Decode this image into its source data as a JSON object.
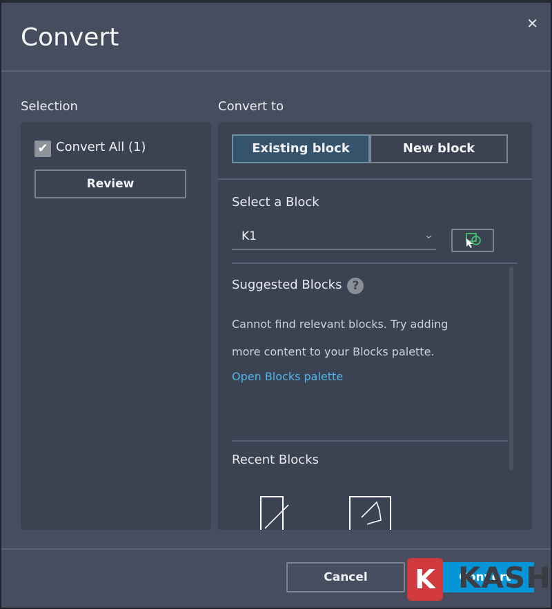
{
  "dialog": {
    "title": "Convert",
    "close_icon": "close-icon"
  },
  "selection": {
    "label": "Selection",
    "convert_all": "Convert All (1)",
    "checked": true,
    "review": "Review"
  },
  "convert_to": {
    "label": "Convert to",
    "tabs": [
      {
        "label": "Existing block",
        "active": true
      },
      {
        "label": "New block",
        "active": false
      }
    ],
    "select_block_label": "Select a Block",
    "select_value": "K1",
    "pick_icon": "pick-block-icon",
    "suggested_label": "Suggested Blocks",
    "help_glyph": "?",
    "message_line1": "Cannot find relevant blocks. Try adding",
    "message_line2": "more content to your Blocks palette.",
    "open_palette": "Open Blocks palette",
    "recent_label": "Recent Blocks"
  },
  "footer": {
    "cancel": "Cancel",
    "convert": "Convert"
  },
  "watermark": {
    "letter": "K",
    "text": "KASHI"
  },
  "colors": {
    "accent": "#0696d7",
    "link": "#4fb5ec",
    "active_tab": "#36536c"
  }
}
